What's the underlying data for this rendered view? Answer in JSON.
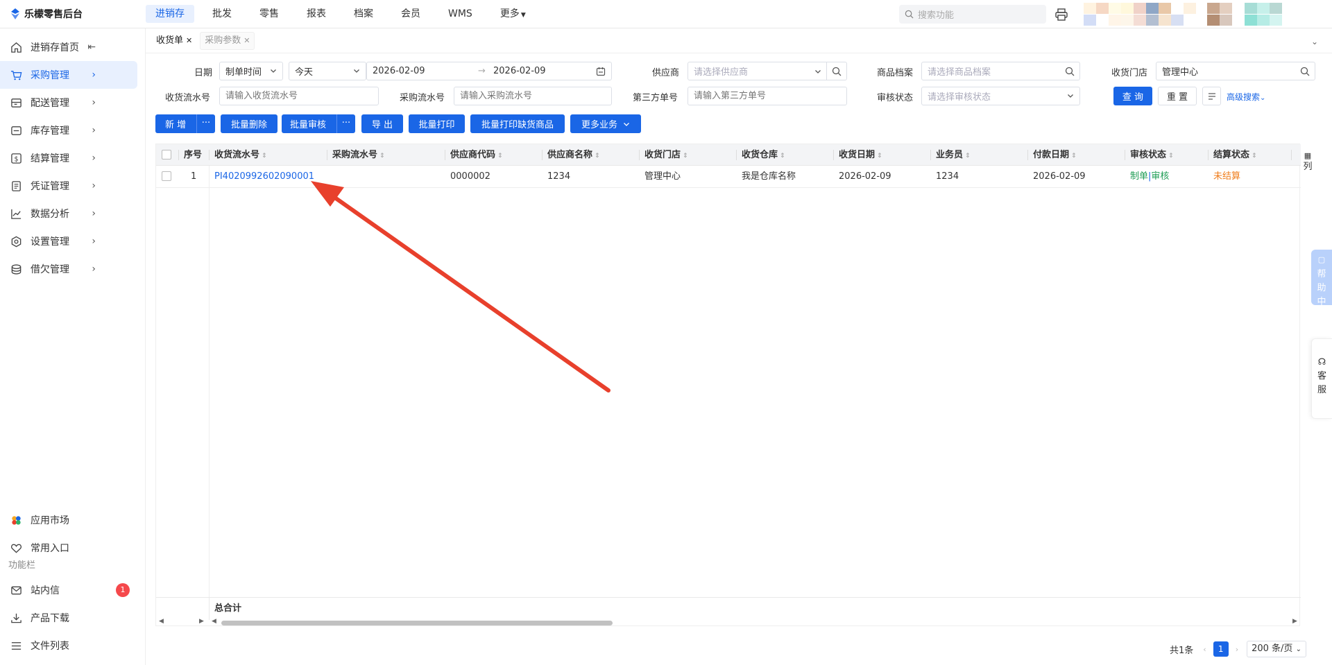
{
  "app": {
    "title": "乐檬零售后台"
  },
  "topnav": {
    "items": [
      "进销存",
      "批发",
      "零售",
      "报表",
      "档案",
      "会员",
      "WMS",
      "更多"
    ],
    "search_placeholder": "搜索功能"
  },
  "sidebar": {
    "items": [
      {
        "label": "进销存首页"
      },
      {
        "label": "采购管理"
      },
      {
        "label": "配送管理"
      },
      {
        "label": "库存管理"
      },
      {
        "label": "结算管理"
      },
      {
        "label": "凭证管理"
      },
      {
        "label": "数据分析"
      },
      {
        "label": "设置管理"
      },
      {
        "label": "借欠管理"
      }
    ],
    "bottom": {
      "app_market": "应用市场",
      "common_entry": "常用入口",
      "section": "功能栏",
      "messages": "站内信",
      "messages_badge": "1",
      "downloads": "产品下载",
      "files": "文件列表"
    }
  },
  "tabs": [
    {
      "label": "收货单"
    },
    {
      "label": "采购参数"
    }
  ],
  "filters": {
    "date_label": "日期",
    "date_type": "制单时间",
    "date_range": "今天",
    "date_from": "2026-02-09",
    "date_to": "2026-02-09",
    "date_arrow": "→",
    "supplier_label": "供应商",
    "supplier_placeholder": "请选择供应商",
    "goods_label": "商品档案",
    "goods_placeholder": "请选择商品档案",
    "store_label": "收货门店",
    "store_value": "管理中心",
    "receipt_no_label": "收货流水号",
    "receipt_no_placeholder": "请输入收货流水号",
    "purchase_no_label": "采购流水号",
    "purchase_no_placeholder": "请输入采购流水号",
    "third_no_label": "第三方单号",
    "third_no_placeholder": "请输入第三方单号",
    "audit_label": "审核状态",
    "audit_placeholder": "请选择审核状态",
    "query": "查 询",
    "reset": "重 置",
    "advanced": "高级搜索"
  },
  "actions": {
    "add": "新 增",
    "batch_delete": "批量删除",
    "batch_audit": "批量审核",
    "export": "导 出",
    "batch_print": "批量打印",
    "batch_print_missing": "批量打印缺货商品",
    "more_business": "更多业务",
    "more_dots": "···"
  },
  "table": {
    "columns": [
      "序号",
      "收货流水号",
      "采购流水号",
      "供应商代码",
      "供应商名称",
      "收货门店",
      "收货仓库",
      "收货日期",
      "业务员",
      "付款日期",
      "审核状态",
      "结算状态"
    ],
    "rows": [
      {
        "index": "1",
        "receipt_no": "PI4020992602090001",
        "purchase_no": "",
        "supplier_code": "0000002",
        "supplier_name": "1234",
        "store": "管理中心",
        "warehouse": "我是仓库名称",
        "receipt_date": "2026-02-09",
        "salesman": "1234",
        "pay_date": "2026-02-09",
        "audit_a": "制单",
        "audit_sep": "|",
        "audit_b": "审核",
        "settle": "未结算"
      }
    ],
    "total_label": "总合计",
    "column_toggle": "列"
  },
  "pager": {
    "total": "共1条",
    "page": "1",
    "size": "200 条/页"
  },
  "floating": {
    "help": "帮助中心",
    "service": "客服"
  },
  "colors": {
    "primary": "#1a66e6",
    "active_bg": "#e8f0fe",
    "arrow": "#e8402c",
    "status_green": "#1f9d55",
    "status_orange": "#ef7d1c"
  }
}
